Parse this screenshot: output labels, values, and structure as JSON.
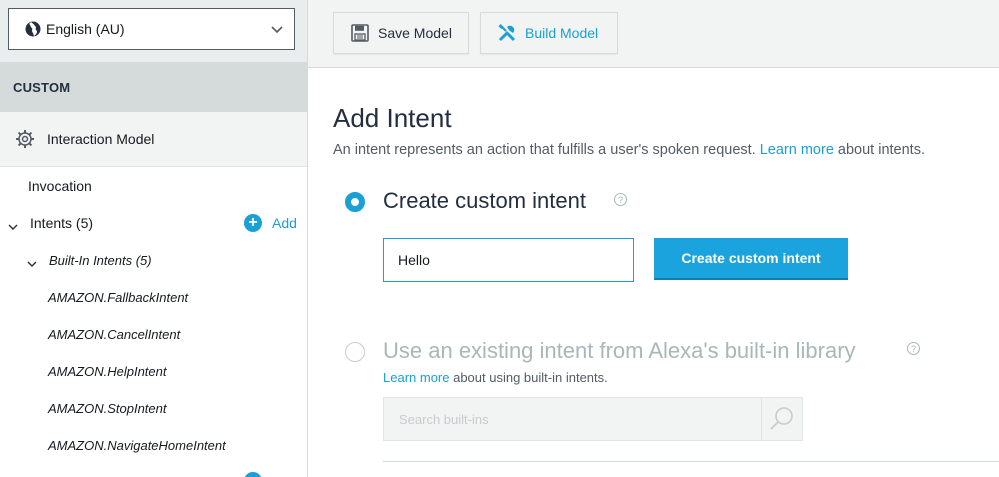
{
  "sidebar": {
    "locale": "English (AU)",
    "section_title": "CUSTOM",
    "interaction_model": "Interaction Model",
    "invocation": "Invocation",
    "intents_label": "Intents (5)",
    "add_label": "Add",
    "builtin_label": "Built-In Intents (5)",
    "builtin_items": [
      "AMAZON.FallbackIntent",
      "AMAZON.CancelIntent",
      "AMAZON.HelpIntent",
      "AMAZON.StopIntent",
      "AMAZON.NavigateHomeIntent"
    ]
  },
  "toolbar": {
    "save_label": "Save Model",
    "build_label": "Build Model"
  },
  "main": {
    "title": "Add Intent",
    "desc_before": "An intent represents an action that fulfills a user's spoken request. ",
    "desc_link": "Learn more",
    "desc_after": " about intents.",
    "option_custom": {
      "label": "Create custom intent",
      "input_value": "Hello",
      "button_label": "Create custom intent"
    },
    "option_builtin": {
      "label": "Use an existing intent from Alexa's built-in library",
      "link": "Learn more",
      "after": " about using built-in intents.",
      "search_placeholder": "Search built-ins"
    },
    "help_glyph": "?"
  },
  "colors": {
    "accent": "#1a9fd6",
    "sidebar_header": "#d5dbdb",
    "toolbar_bg": "#f2f3f3"
  }
}
